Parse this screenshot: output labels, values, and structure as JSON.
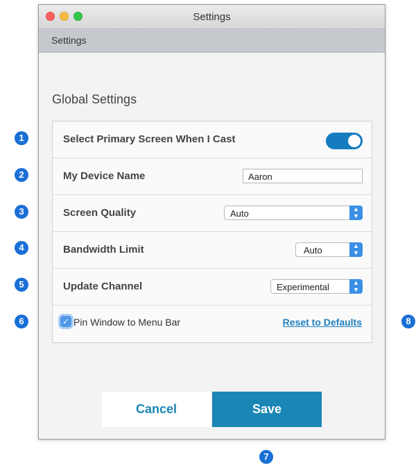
{
  "window": {
    "title": "Settings",
    "subbar_title": "Settings"
  },
  "section_title": "Global Settings",
  "rows": {
    "primary_screen": {
      "label": "Select Primary Screen When I Cast",
      "toggle_on": true
    },
    "device_name": {
      "label": "My Device Name",
      "value": "Aaron"
    },
    "screen_quality": {
      "label": "Screen Quality",
      "value": "Auto"
    },
    "bandwidth_limit": {
      "label": "Bandwidth Limit",
      "value": "Auto"
    },
    "update_channel": {
      "label": "Update Channel",
      "value": "Experimental"
    },
    "footer": {
      "checkbox_label": "Pin Window to Menu Bar",
      "checked": true,
      "reset_label": "Reset to Defaults"
    }
  },
  "buttons": {
    "cancel_label": "Cancel",
    "save_label": "Save"
  },
  "badges": [
    "1",
    "2",
    "3",
    "4",
    "5",
    "6",
    "7",
    "8"
  ],
  "colors": {
    "accent": "#1a86b5",
    "toggle": "#157cc0",
    "badge": "#1a6fd6",
    "select_arrow": "#3a8fe6"
  }
}
